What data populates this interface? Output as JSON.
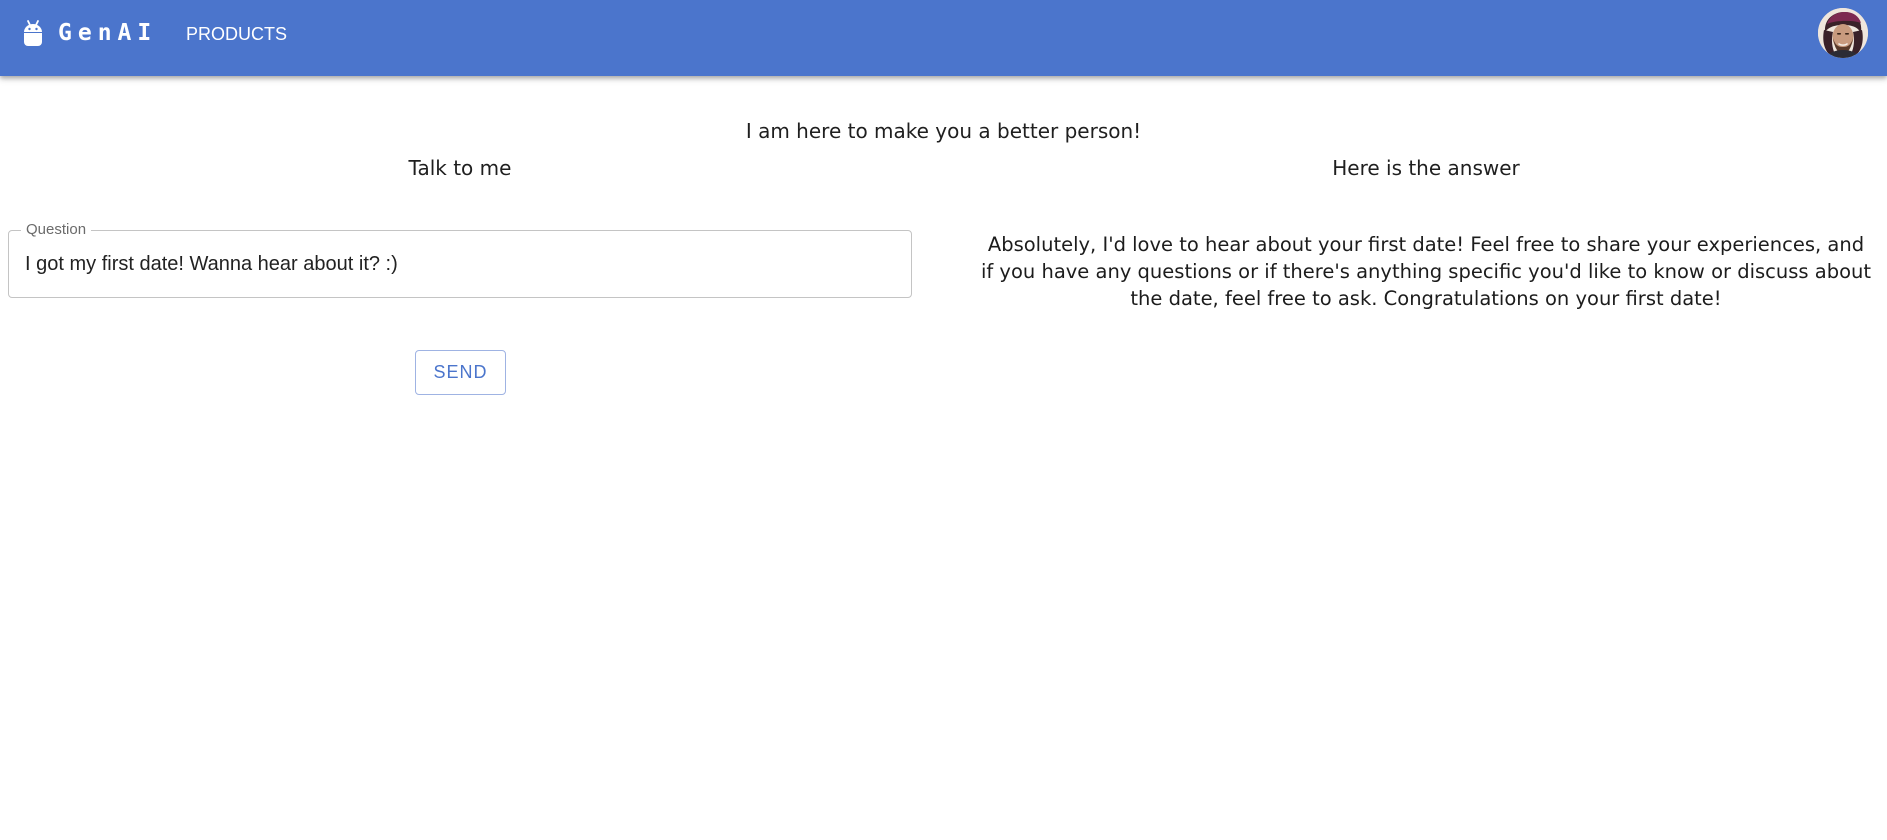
{
  "header": {
    "brand": "GenAI",
    "nav": {
      "products_label": "PRODUCTS"
    },
    "logo_icon": "android-icon",
    "avatar_icon": "user-avatar",
    "background_color": "#4b75cc"
  },
  "main": {
    "tagline": "I am here to make you a better person!",
    "left": {
      "heading": "Talk to me",
      "question_label": "Question",
      "question_value": "I got my first date! Wanna hear about it? :)",
      "send_label": "SEND"
    },
    "right": {
      "heading": "Here is the answer",
      "answer": "Absolutely, I'd love to hear about your first date! Feel free to share your experiences, and if you have any questions or if there's anything specific you'd like to know or discuss about the date, feel free to ask. Congratulations on your first date!"
    }
  }
}
